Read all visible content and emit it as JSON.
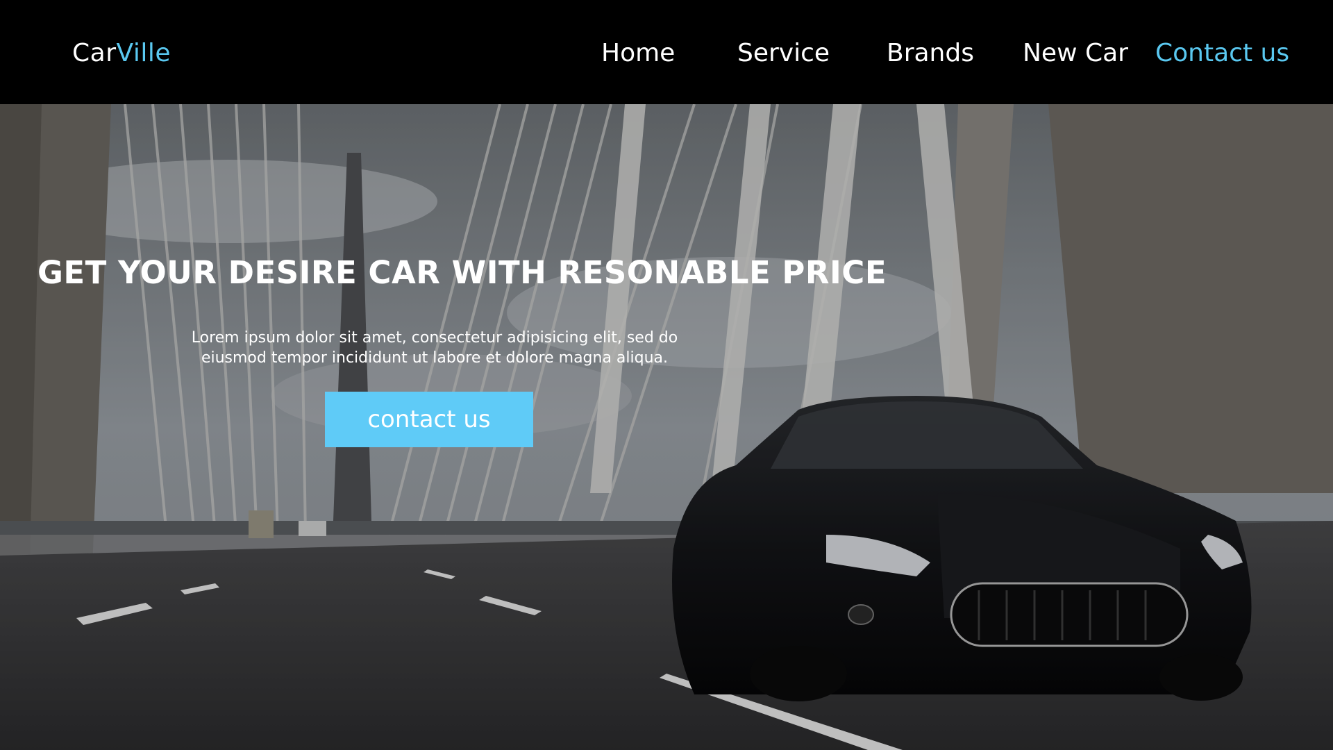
{
  "brand": {
    "part1": "Car",
    "part2": "Ville"
  },
  "nav": {
    "home": "Home",
    "service": "Service",
    "brands": "Brands",
    "new_car": "New Car",
    "contact": "Contact us"
  },
  "hero": {
    "title": "GET YOUR DESIRE CAR WITH RESONABLE PRICE",
    "desc_line1": "Lorem ipsum dolor sit amet, consectetur adipisicing elit, sed do",
    "desc_line2": "eiusmod tempor incididunt ut labore et dolore magna aliqua.",
    "cta_label": "contact us"
  },
  "colors": {
    "accent": "#5ac8f0",
    "cta_bg": "#5fcbf7",
    "nav_bg": "#000000"
  }
}
